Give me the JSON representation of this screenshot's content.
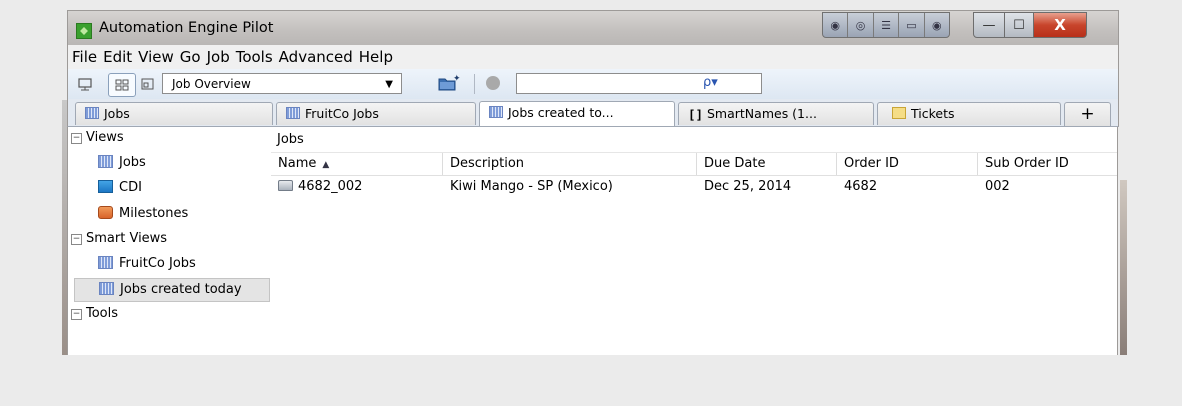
{
  "window": {
    "title": "Automation Engine Pilot",
    "close_symbol": "X",
    "min_symbol": "—",
    "max_symbol": "☐"
  },
  "menu": [
    "File",
    "Edit",
    "View",
    "Go",
    "Job",
    "Tools",
    "Advanced",
    "Help"
  ],
  "toolbar": {
    "view_select_value": "Job Overview",
    "search_value": "",
    "search_icon_glyph": "ρ▾"
  },
  "tabs": [
    {
      "label": "Jobs",
      "icon": "jobs-icon"
    },
    {
      "label": "FruitCo Jobs",
      "icon": "jobs-icon"
    },
    {
      "label": "Jobs created to...",
      "icon": "jobs-icon",
      "active": true
    },
    {
      "label": "SmartNames (1...",
      "icon": "smartnames-icon"
    },
    {
      "label": "Tickets",
      "icon": "tickets-icon"
    }
  ],
  "add_tab_label": "+",
  "sidebar": {
    "groups": [
      {
        "label": "Views",
        "items": [
          "Jobs",
          "CDI",
          "Milestones"
        ]
      },
      {
        "label": "Smart Views",
        "items": [
          "FruitCo Jobs",
          "Jobs created today"
        ]
      },
      {
        "label": "Tools",
        "items": []
      }
    ],
    "selected_item": "Jobs created today"
  },
  "main": {
    "label": "Jobs",
    "columns": [
      "Name",
      "Description",
      "Due Date",
      "Order ID",
      "Sub Order ID"
    ],
    "sort_column": "Name",
    "sort_direction": "ascending",
    "rows": [
      {
        "name": "4682_002",
        "description": "Kiwi Mango - SP (Mexico)",
        "due_date": "Dec 25, 2014",
        "order_id": "4682",
        "sub_order_id": "002"
      }
    ]
  },
  "colors": {
    "background": "#ebebeb",
    "titlebar": "#c2bfbd",
    "toolbar": "#dde7f2",
    "close_button": "#c8452c",
    "selection": "#e4e4e4"
  }
}
